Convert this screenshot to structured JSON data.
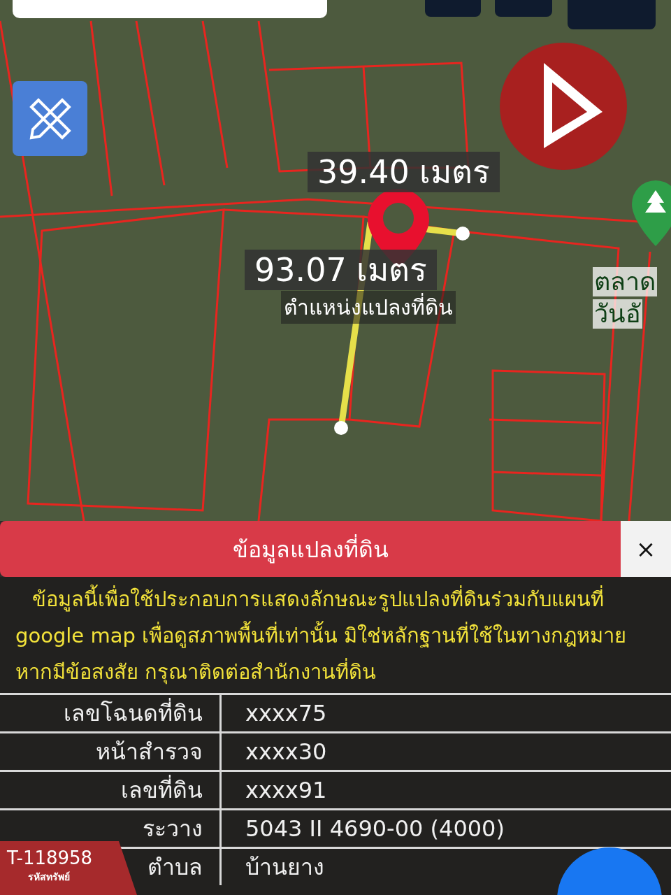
{
  "map": {
    "labels": [
      {
        "text": "39.40 เมตร",
        "kind": "measure"
      },
      {
        "text": "93.07 เมตร",
        "kind": "measure"
      },
      {
        "text": "ตำแหน่งแปลงที่ดิน",
        "kind": "place"
      },
      {
        "text": "ตลาด",
        "kind": "poi"
      },
      {
        "text": "วันอั",
        "kind": "poi"
      }
    ]
  },
  "panel": {
    "title": "ข้อมูลแปลงที่ดิน",
    "close": "×",
    "notice": "ข้อมูลนี้เพื่อใช้ประกอบการแสดงลักษณะรูปแปลงที่ดินร่วมกับแผนที่ google map เพื่อดูสภาพพื้นที่เท่านั้น มิใช่หลักฐานที่ใช้ในทางกฎหมาย หากมีข้อสงสัย กรุณาติดต่อสำนักงานที่ดิน",
    "rows": [
      {
        "label": "เลขโฉนดที่ดิน",
        "value": "xxxx75"
      },
      {
        "label": "หน้าสำรวจ",
        "value": "xxxx30"
      },
      {
        "label": "เลขที่ดิน",
        "value": "xxxx91"
      },
      {
        "label": "ระวาง",
        "value": "5043 II 4690-00 (4000)"
      },
      {
        "label": "ตำบล",
        "value": "บ้านยาง"
      }
    ]
  },
  "badge": {
    "code": "T-118958",
    "label": "รหัสทรัพย์"
  }
}
